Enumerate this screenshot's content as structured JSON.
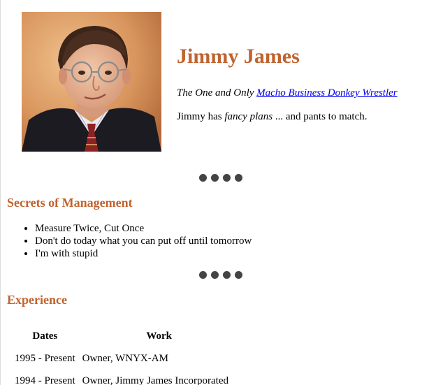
{
  "profile": {
    "name": "Jimmy James",
    "tagline_prefix": "The One and Only ",
    "tagline_link": "Macho Business Donkey Wrestler",
    "desc_prefix": "Jimmy has ",
    "desc_emphasis": "fancy plans",
    "desc_suffix": " ... and pants to match."
  },
  "sections": {
    "management_title": "Secrets of Management",
    "management_items": [
      "Measure Twice, Cut Once",
      "Don't do today what you can put off until tomorrow",
      "I'm with stupid"
    ],
    "experience_title": "Experience"
  },
  "experience": {
    "headers": {
      "dates": "Dates",
      "work": "Work"
    },
    "rows": [
      {
        "dates": "1995 - Present",
        "work": "Owner, WNYX-AM"
      },
      {
        "dates": "1994 - Present",
        "work": "Owner, Jimmy James Incorporated"
      }
    ]
  },
  "colors": {
    "heading": "#c0632e",
    "link": "#0000ee",
    "dots": "#444444"
  }
}
